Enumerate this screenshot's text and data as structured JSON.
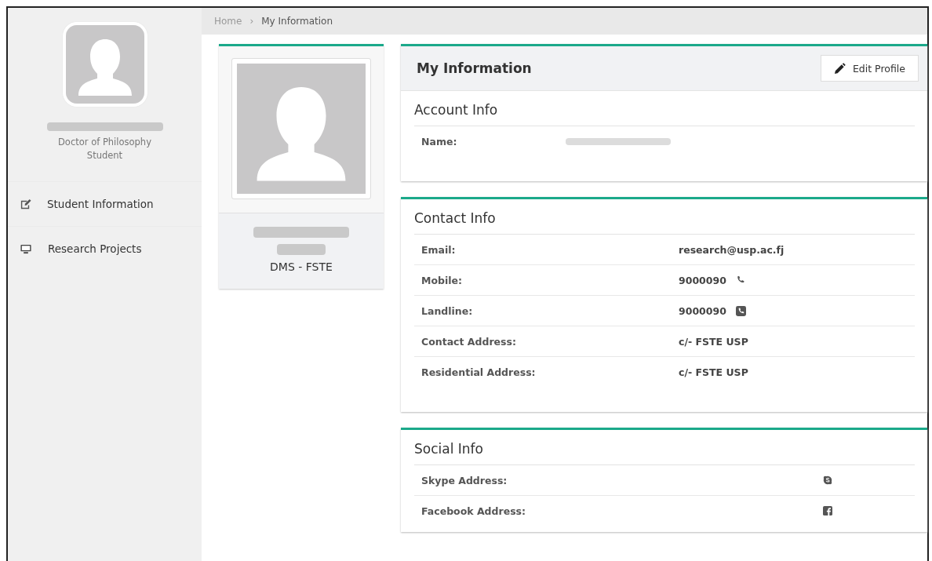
{
  "sidebar": {
    "profile": {
      "name_redacted": true,
      "degree": "Doctor of Philosophy",
      "role": "Student"
    },
    "items": [
      {
        "kind": "edit",
        "label": "Student Information",
        "selected": false
      },
      {
        "kind": "monitor",
        "label": "Research Projects",
        "selected": false
      }
    ]
  },
  "breadcrumb": {
    "separator": "›",
    "items": [
      {
        "label": "Home",
        "current": false
      },
      {
        "label": "My Information",
        "current": true
      }
    ]
  },
  "profile_card": {
    "name_redacted": true,
    "department": "DMS - FSTE"
  },
  "panel": {
    "title": "My Information",
    "edit_button": "Edit Profile"
  },
  "sections": [
    {
      "kind": "account",
      "title": "Account Info",
      "rows": [
        {
          "label": "Name:",
          "redacted": true
        }
      ]
    },
    {
      "kind": "contact",
      "title": "Contact Info",
      "rows": [
        {
          "label": "Email:",
          "value": "research@usp.ac.fj"
        },
        {
          "label": "Mobile:",
          "value": "9000090",
          "kind": "phone"
        },
        {
          "label": "Landline:",
          "value": "9000090",
          "kind": "phone-square"
        },
        {
          "label": "Contact Address:",
          "value": "c/- FSTE USP"
        },
        {
          "label": "Residential Address:",
          "value": "c/- FSTE USP"
        }
      ]
    },
    {
      "kind": "social",
      "title": "Social Info",
      "rows": [
        {
          "label": "Skype Address:",
          "kind": "skype"
        },
        {
          "label": "Facebook Address:",
          "kind": "facebook"
        }
      ]
    }
  ]
}
